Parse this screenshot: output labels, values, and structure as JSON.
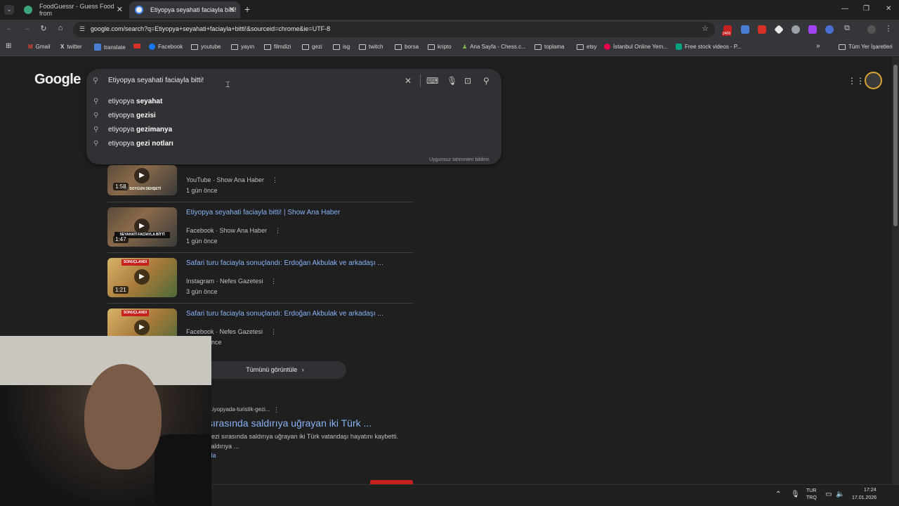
{
  "tabs": [
    {
      "title": "FoodGuessr - Guess Food from",
      "close": "✕"
    },
    {
      "title": "Etiyopya seyahati faciayla bitti!",
      "close": "✕"
    }
  ],
  "new_tab": "+",
  "window_controls": {
    "minimize": "—",
    "restore": "❐",
    "close": "✕"
  },
  "toolbar": {
    "url": "google.com/search?q=Etiyopya+seyahati+faciayla+bitti!&sourceid=chrome&ie=UTF-8",
    "ext_badge": "2406"
  },
  "bookmarks": [
    "Gmail",
    "twitter",
    "translate",
    "",
    "Facebook",
    "youtube",
    "yayın",
    "filmdizi",
    "gezi",
    "isg",
    "twitch",
    "borsa",
    "kripto",
    "Ana Sayfa - Chess.c...",
    "toplama",
    "etsy",
    "İstanbul Online Yem...",
    "Free stock videos - P...",
    "Tüm Yer İşaretleri"
  ],
  "search": {
    "logo": "Google",
    "query": "Etiyopya seyahati faciayla bitti!",
    "suggestions": [
      {
        "prefix": "etiyopya ",
        "bold": "seyahat"
      },
      {
        "prefix": "etiyopya ",
        "bold": "gezisi"
      },
      {
        "prefix": "etiyopya ",
        "bold": "gezimanya"
      },
      {
        "prefix": "etiyopya ",
        "bold": "gezi notları"
      }
    ],
    "report": "Uygunsuz tahminleri bildirin"
  },
  "videos": [
    {
      "duration": "1:58",
      "caption": "DE SOYGUN DEHŞETİ",
      "source": "YouTube · Show Ana Haber",
      "date": "1 gün önce"
    },
    {
      "duration": "1:47",
      "caption": "SEYAHATİ FACİAYLA BİTTİ",
      "title": "Etiyopya seyahati faciayla bitti! | Show Ana Haber",
      "source": "Facebook · Show Ana Haber",
      "date": "1 gün önce"
    },
    {
      "duration": "1:21",
      "caption": "SONUÇLANDI",
      "title": "Safari turu faciayla sonuçlandı: Erdoğan Akbulak ve arkadaşı ...",
      "source": "Instagram · Nefes Gazetesi",
      "date": "3 gün önce"
    },
    {
      "duration": "",
      "caption": "SONUÇLANDI",
      "title": "Safari turu faciayla sonuçlandı: Erdoğan Akbulak ve arkadaşı ...",
      "source": "Facebook · Nefes Gazetesi",
      "date": "önce"
    }
  ],
  "view_all": "Tümünü görüntüle",
  "result": {
    "url": "...iyopyada-turistik-gezi...",
    "title": "sırasında saldırıya uğrayan iki Türk ...",
    "snippet": "gezi sırasında saldırıya uğrayan iki Türk vatandaşı hayatını kaybetti. saldırıya ...",
    "more": "yla"
  },
  "taskbar": {
    "lang": "TUR",
    "layout": "TRQ",
    "time": "17:24",
    "date": "17.01.2026"
  }
}
